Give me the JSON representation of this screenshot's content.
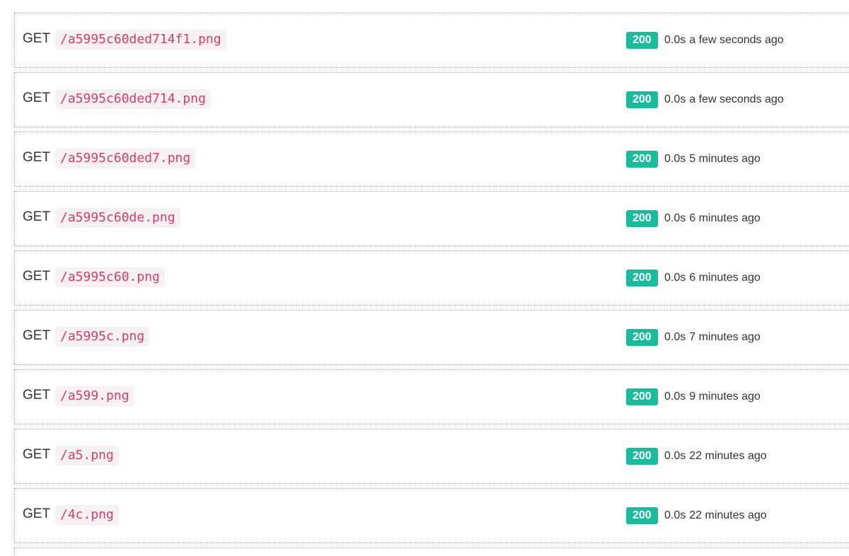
{
  "requests": [
    {
      "method": "GET",
      "path": "/a5995c60ded714f1.png",
      "status": "200",
      "duration": "0.0s",
      "ago": "a few seconds ago"
    },
    {
      "method": "GET",
      "path": "/a5995c60ded714.png",
      "status": "200",
      "duration": "0.0s",
      "ago": "a few seconds ago"
    },
    {
      "method": "GET",
      "path": "/a5995c60ded7.png",
      "status": "200",
      "duration": "0.0s",
      "ago": "5 minutes ago"
    },
    {
      "method": "GET",
      "path": "/a5995c60de.png",
      "status": "200",
      "duration": "0.0s",
      "ago": "6 minutes ago"
    },
    {
      "method": "GET",
      "path": "/a5995c60.png",
      "status": "200",
      "duration": "0.0s",
      "ago": "6 minutes ago"
    },
    {
      "method": "GET",
      "path": "/a5995c.png",
      "status": "200",
      "duration": "0.0s",
      "ago": "7 minutes ago"
    },
    {
      "method": "GET",
      "path": "/a599.png",
      "status": "200",
      "duration": "0.0s",
      "ago": "9 minutes ago"
    },
    {
      "method": "GET",
      "path": "/a5.png",
      "status": "200",
      "duration": "0.0s",
      "ago": "22 minutes ago"
    },
    {
      "method": "GET",
      "path": "/4c.png",
      "status": "200",
      "duration": "0.0s",
      "ago": "22 minutes ago"
    }
  ],
  "colors": {
    "status_ok": "#1abc9c",
    "path_text": "#d43f62",
    "path_bg": "#f8f1f3"
  }
}
